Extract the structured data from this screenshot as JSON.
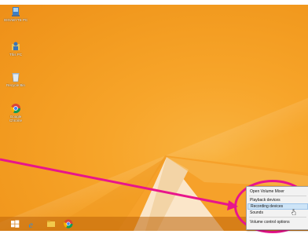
{
  "desktop": {
    "icons": [
      {
        "name": "computer",
        "label": "GIGABYTE PC"
      },
      {
        "name": "user-folder",
        "label": "This PC"
      },
      {
        "name": "recycle-bin",
        "label": "Recycle Bin"
      },
      {
        "name": "chrome",
        "label": "Google\nChrome"
      }
    ]
  },
  "taskbar": {
    "buttons": [
      "start-icon",
      "internet-explorer-icon",
      "file-explorer-icon",
      "chrome-icon"
    ]
  },
  "context_menu": {
    "items": [
      {
        "label": "Open Volume Mixer"
      },
      {
        "label": "Playback devices"
      },
      {
        "label": "Recording devices"
      },
      {
        "label": "Sounds"
      },
      {
        "label": "Volume control options"
      }
    ],
    "highlighted": "Recording devices"
  },
  "colors": {
    "desktop": "#f7a52a",
    "callout": "#e8158c",
    "menu_bg": "#f2f2f2",
    "menu_highlight": "#cde4f7"
  }
}
